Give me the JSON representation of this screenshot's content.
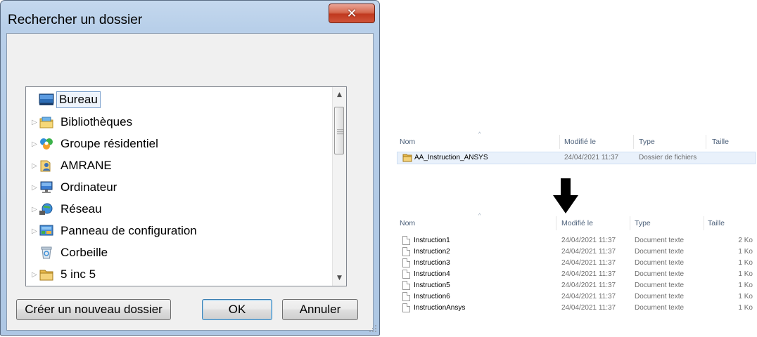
{
  "dialog": {
    "title": "Rechercher un dossier",
    "tree": [
      {
        "label": "Bureau",
        "icon": "desktop-icon",
        "expandable": false,
        "selected": true
      },
      {
        "label": "Bibliothèques",
        "icon": "libraries-icon",
        "expandable": true
      },
      {
        "label": "Groupe résidentiel",
        "icon": "homegroup-icon",
        "expandable": true
      },
      {
        "label": "AMRANE",
        "icon": "user-folder-icon",
        "expandable": true
      },
      {
        "label": "Ordinateur",
        "icon": "computer-icon",
        "expandable": true
      },
      {
        "label": "Réseau",
        "icon": "network-icon",
        "expandable": true
      },
      {
        "label": "Panneau de configuration",
        "icon": "control-panel-icon",
        "expandable": true
      },
      {
        "label": "Corbeille",
        "icon": "recycle-bin-icon",
        "expandable": false
      },
      {
        "label": "5 inc 5",
        "icon": "folder-icon",
        "expandable": true
      }
    ],
    "buttons": {
      "new_folder": "Créer un nouveau dossier",
      "ok": "OK",
      "cancel": "Annuler"
    }
  },
  "explorer_top": {
    "columns": {
      "name": "Nom",
      "modified": "Modifié le",
      "type": "Type",
      "size": "Taille"
    },
    "rows": [
      {
        "name": "AA_Instruction_ANSYS",
        "modified": "24/04/2021 11:37",
        "type": "Dossier de fichiers",
        "size": ""
      }
    ]
  },
  "explorer_bottom": {
    "columns": {
      "name": "Nom",
      "modified": "Modifié le",
      "type": "Type",
      "size": "Taille"
    },
    "rows": [
      {
        "name": "Instruction1",
        "modified": "24/04/2021 11:37",
        "type": "Document texte",
        "size": "2 Ko"
      },
      {
        "name": "Instruction2",
        "modified": "24/04/2021 11:37",
        "type": "Document texte",
        "size": "1 Ko"
      },
      {
        "name": "Instruction3",
        "modified": "24/04/2021 11:37",
        "type": "Document texte",
        "size": "1 Ko"
      },
      {
        "name": "Instruction4",
        "modified": "24/04/2021 11:37",
        "type": "Document texte",
        "size": "1 Ko"
      },
      {
        "name": "Instruction5",
        "modified": "24/04/2021 11:37",
        "type": "Document texte",
        "size": "1 Ko"
      },
      {
        "name": "Instruction6",
        "modified": "24/04/2021 11:37",
        "type": "Document texte",
        "size": "1 Ko"
      },
      {
        "name": "InstructionAnsys",
        "modified": "24/04/2021 11:37",
        "type": "Document texte",
        "size": "1 Ko"
      }
    ]
  }
}
